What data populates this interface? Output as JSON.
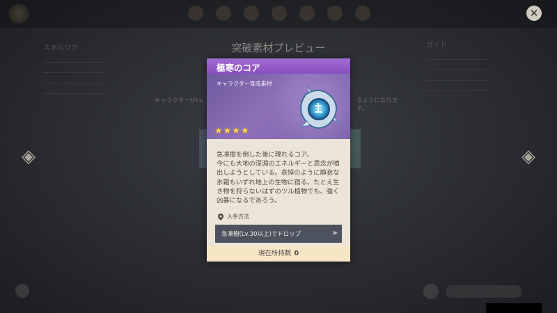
{
  "background": {
    "page_title": "突破素材プレビュー",
    "subtitle_left": "キャラクターがLv.",
    "subtitle_right": "るようになります。",
    "left_column_heading": "スキルワク",
    "right_column_heading": "ガイド"
  },
  "item": {
    "name": "極寒のコア",
    "category": "キャラクター育成素材",
    "rarity": 4,
    "stars_text": "★★★★",
    "description": "急凍樹を倒した後に現れるコア。\n今にも大地の深淵のエネルギーと思念が噴出しようとしている。哀悼のように静寂な氷霜もいずれ地上の生物に宿る。たとえ生き物を狩らないはずのツル植物でも、強く凶暴になるであろう。",
    "acquisition_label": "入手方法",
    "source": "急凍樹(Lv.30以上)でドロップ",
    "owned_label": "現在所持数",
    "owned_count": "0"
  },
  "colors": {
    "header_purple": "#9a5fcb",
    "banner_purple": "#7f66ad",
    "star_gold": "#ffd54a",
    "card_bg": "#ece4d7",
    "footer_bg": "#f7e6c6",
    "source_btn": "#4c535f"
  }
}
